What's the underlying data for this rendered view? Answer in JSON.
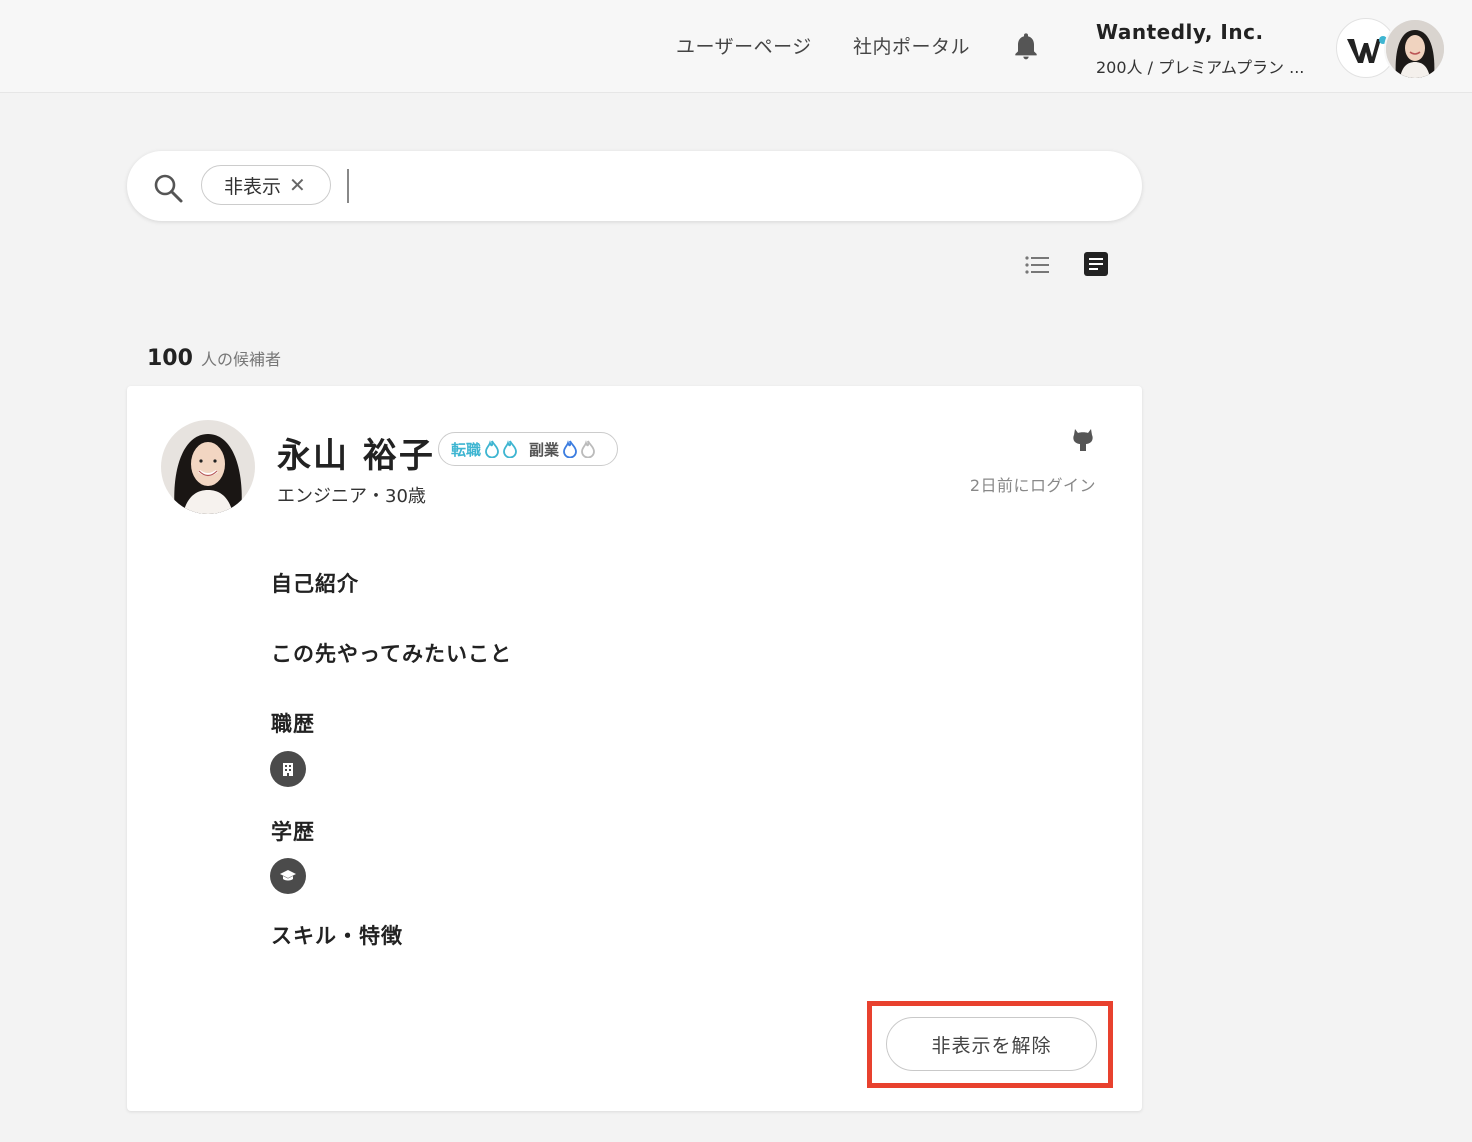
{
  "header": {
    "nav": [
      "ユーザーページ",
      "社内ポータル"
    ],
    "company_name": "Wantedly, Inc.",
    "company_sub": "200人 / プレミアムプラン ...",
    "icons": [
      "bell-icon",
      "company-logo",
      "user-avatar"
    ]
  },
  "search": {
    "chip_label": "非表示",
    "chip_close": "✕",
    "value": ""
  },
  "results": {
    "count": "100",
    "count_label": "人の候補者"
  },
  "candidate": {
    "name": "永山 裕子",
    "status_job": "転職",
    "status_side": "副業",
    "role_age": "エンジニア・30歳",
    "last_login": "2日前にログイン",
    "sections": {
      "intro": "自己紹介",
      "future": "この先やってみたいこと",
      "career": "職歴",
      "education": "学歴",
      "skills": "スキル・特徴"
    },
    "unhide_button": "非表示を解除"
  },
  "colors": {
    "accent": "#3eb5d1",
    "highlight": "#e8412e",
    "flame_blue": "#3c7de0"
  }
}
